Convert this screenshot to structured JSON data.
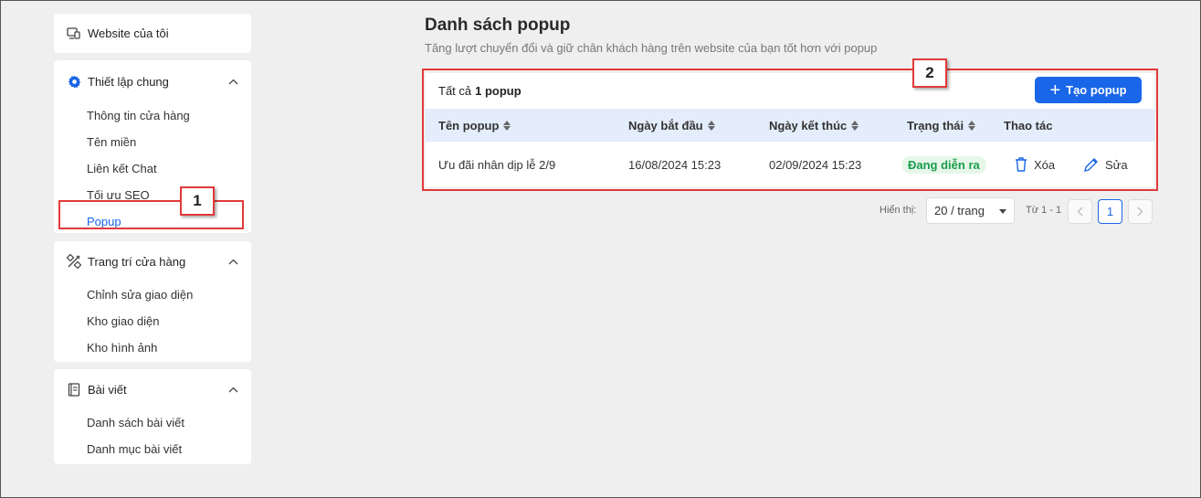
{
  "sidebar": {
    "website": "Website của tôi",
    "general": {
      "title": "Thiết lập chung",
      "items": [
        "Thông tin cửa hàng",
        "Tên miền",
        "Liên kết Chat",
        "Tối ưu SEO",
        "Popup"
      ]
    },
    "decor": {
      "title": "Trang trí cửa hàng",
      "items": [
        "Chỉnh sửa giao diện",
        "Kho giao diện",
        "Kho hình ảnh"
      ]
    },
    "posts": {
      "title": "Bài viết",
      "items": [
        "Danh sách bài viết",
        "Danh mục bài viết"
      ]
    }
  },
  "main": {
    "title": "Danh sách popup",
    "subtitle": "Tăng lượt chuyển đổi và giữ chân khách hàng trên website của bạn tốt hơn với popup",
    "count_prefix": "Tất cả",
    "count_value": "1 popup",
    "create_label": "Tạo popup",
    "columns": [
      "Tên popup",
      "Ngày bắt đầu",
      "Ngày kết thúc",
      "Trạng thái",
      "Thao tác"
    ],
    "rows": [
      {
        "name": "Ưu đãi nhân dịp lễ 2/9",
        "start": "16/08/2024 15:23",
        "end": "02/09/2024 15:23",
        "status": "Đang diễn ra",
        "delete": "Xóa",
        "edit": "Sửa"
      }
    ]
  },
  "pagination": {
    "show_label": "Hiển thị:",
    "page_size": "20 / trang",
    "range": "Từ 1 - 1",
    "current": "1"
  },
  "annotations": {
    "badge1": "1",
    "badge2": "2"
  },
  "colors": {
    "accent": "#1a66e8",
    "status_green": "#1a9d4b",
    "annotation_red": "#e23a3a"
  }
}
